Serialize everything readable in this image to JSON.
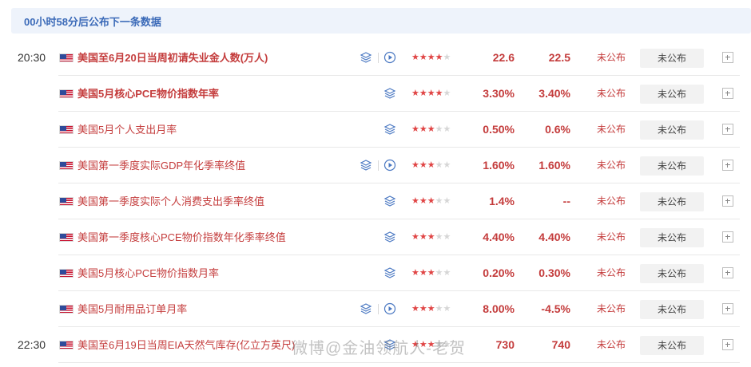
{
  "countdown": "00小时58分后公布下一条数据",
  "rows": [
    {
      "time": "20:30",
      "name": "美国至6月20日当周初请失业金人数(万人)",
      "bold": true,
      "video": true,
      "stars": 4,
      "prev": "22.6",
      "forecast": "22.5",
      "actual": "未公布",
      "button": "未公布"
    },
    {
      "time": "",
      "name": "美国5月核心PCE物价指数年率",
      "bold": true,
      "video": false,
      "stars": 4,
      "prev": "3.30%",
      "forecast": "3.40%",
      "actual": "未公布",
      "button": "未公布"
    },
    {
      "time": "",
      "name": "美国5月个人支出月率",
      "bold": false,
      "video": false,
      "stars": 3,
      "prev": "0.50%",
      "forecast": "0.6%",
      "actual": "未公布",
      "button": "未公布"
    },
    {
      "time": "",
      "name": "美国第一季度实际GDP年化季率终值",
      "bold": false,
      "video": true,
      "stars": 3,
      "prev": "1.60%",
      "forecast": "1.60%",
      "actual": "未公布",
      "button": "未公布"
    },
    {
      "time": "",
      "name": "美国第一季度实际个人消费支出季率终值",
      "bold": false,
      "video": false,
      "stars": 3,
      "prev": "1.4%",
      "forecast": "--",
      "actual": "未公布",
      "button": "未公布"
    },
    {
      "time": "",
      "name": "美国第一季度核心PCE物价指数年化季率终值",
      "bold": false,
      "video": false,
      "stars": 3,
      "prev": "4.40%",
      "forecast": "4.40%",
      "actual": "未公布",
      "button": "未公布"
    },
    {
      "time": "",
      "name": "美国5月核心PCE物价指数月率",
      "bold": false,
      "video": false,
      "stars": 3,
      "prev": "0.20%",
      "forecast": "0.30%",
      "actual": "未公布",
      "button": "未公布"
    },
    {
      "time": "",
      "name": "美国5月耐用品订单月率",
      "bold": false,
      "video": true,
      "stars": 3,
      "prev": "8.00%",
      "forecast": "-4.5%",
      "actual": "未公布",
      "button": "未公布"
    },
    {
      "time": "22:30",
      "name": "美国至6月19日当周EIA天然气库存(亿立方英尺)",
      "bold": false,
      "video": false,
      "stars": 3,
      "prev": "730",
      "forecast": "740",
      "actual": "未公布",
      "button": "未公布"
    }
  ],
  "watermark": "微博@金油领航人-老贺",
  "colors": {
    "accent": "#c43c3c",
    "star": "#e04545",
    "banner_bg": "#eef3fb",
    "banner_text": "#3b6ab8",
    "icon": "#4a78c2"
  }
}
